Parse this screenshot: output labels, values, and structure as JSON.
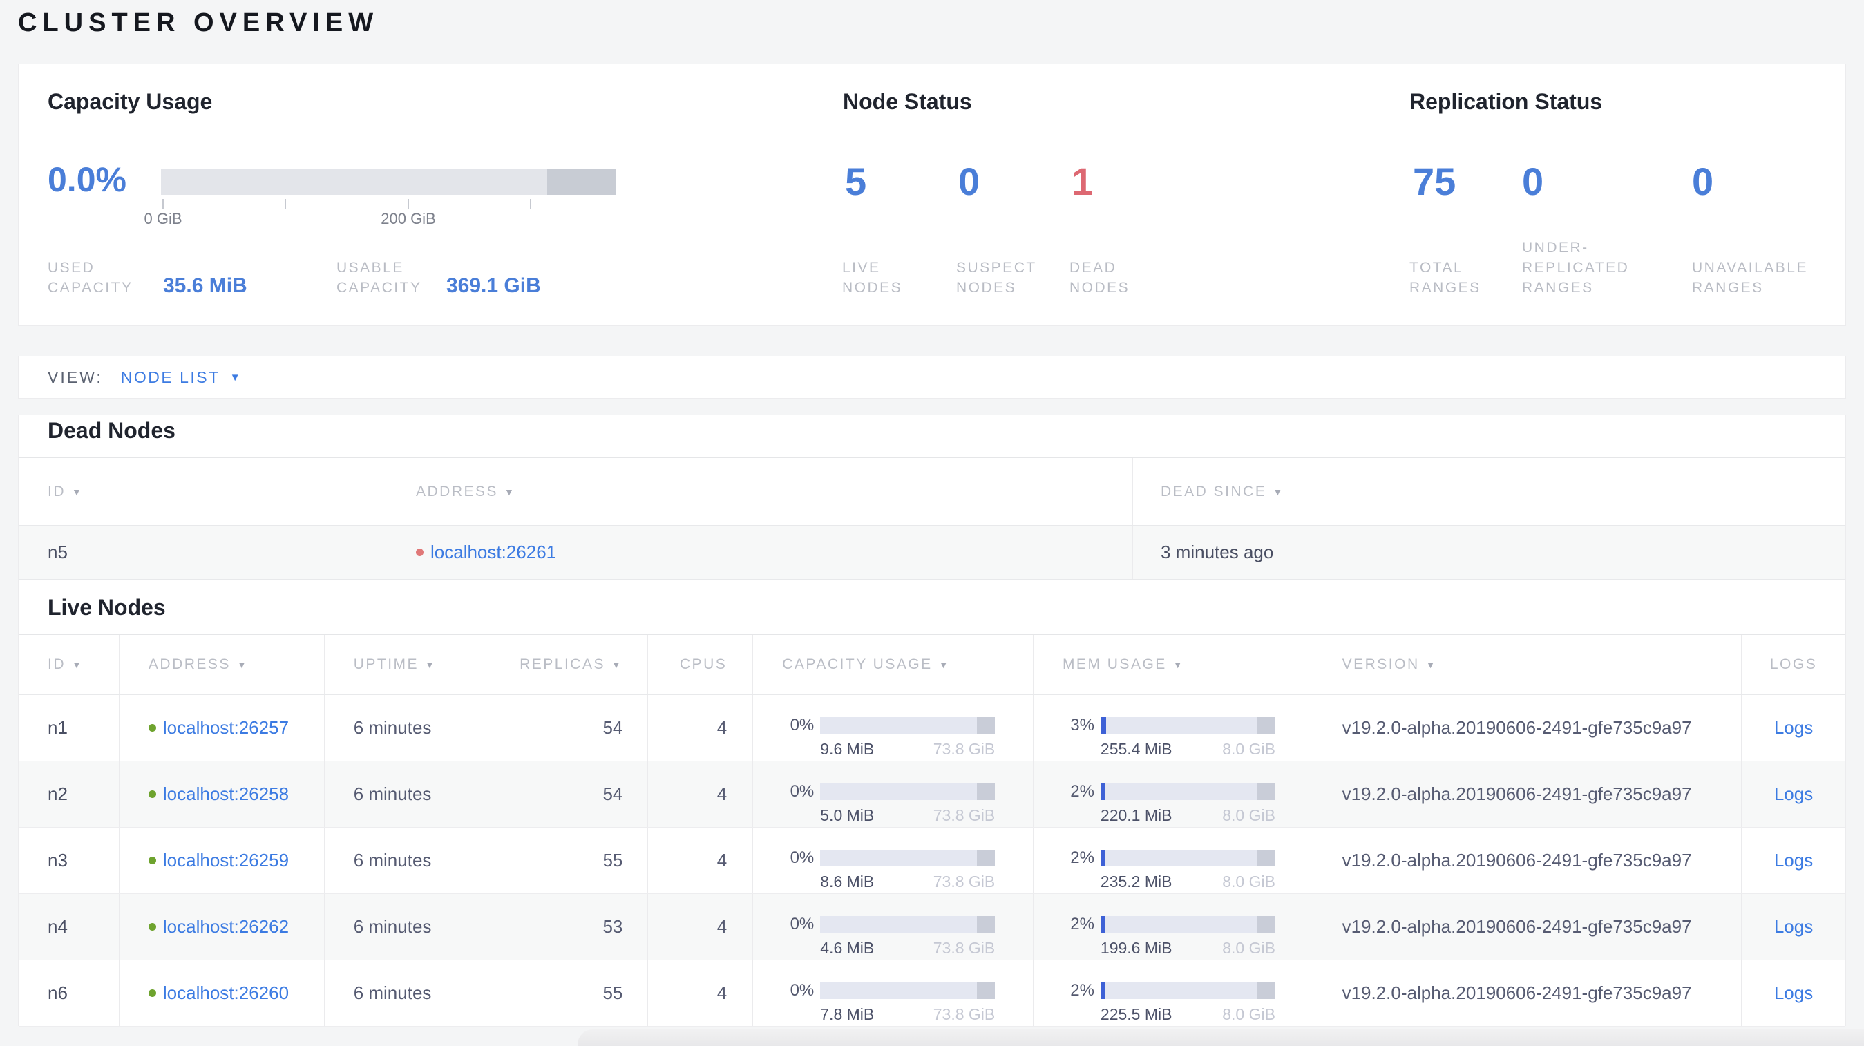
{
  "page": {
    "title": "CLUSTER OVERVIEW"
  },
  "icons": {
    "sort_desc": "▼",
    "dropdown_caret": "▼"
  },
  "colors": {
    "accent_blue": "#4a7ed8",
    "link_blue": "#3c7be2",
    "alert_red": "#dd6872",
    "live_dot_green": "#6ea32e",
    "dead_dot_red": "#e07878",
    "bar_track": "#e4e7f1",
    "bar_reserved": "#c9cdd8",
    "bar_fill_blue": "#3e61d6"
  },
  "summary": {
    "capacity": {
      "title": "Capacity Usage",
      "percent": "0.0%",
      "axis": {
        "tick0_label": "0 GiB",
        "tick2_label": "200 GiB"
      },
      "used": {
        "label": "USED CAPACITY",
        "value": "35.6 MiB"
      },
      "usable": {
        "label": "USABLE CAPACITY",
        "value": "369.1 GiB"
      }
    },
    "node_status": {
      "title": "Node Status",
      "live": {
        "value": "5",
        "label": "LIVE NODES"
      },
      "suspect": {
        "value": "0",
        "label": "SUSPECT NODES"
      },
      "dead": {
        "value": "1",
        "label": "DEAD NODES"
      }
    },
    "replication": {
      "title": "Replication Status",
      "total": {
        "value": "75",
        "label": "TOTAL RANGES"
      },
      "under": {
        "value": "0",
        "label": "UNDER-REPLICATED RANGES"
      },
      "unavailable": {
        "value": "0",
        "label": "UNAVAILABLE RANGES"
      }
    }
  },
  "view_bar": {
    "label": "VIEW:",
    "selected": "NODE LIST"
  },
  "dead_nodes": {
    "title": "Dead Nodes",
    "columns": {
      "id": "ID",
      "address": "ADDRESS",
      "dead_since": "DEAD SINCE"
    },
    "rows": [
      {
        "id": "n5",
        "address": "localhost:26261",
        "dead_since": "3 minutes ago"
      }
    ]
  },
  "live_nodes": {
    "title": "Live Nodes",
    "columns": {
      "id": "ID",
      "address": "ADDRESS",
      "uptime": "UPTIME",
      "replicas": "REPLICAS",
      "cpus": "CPUS",
      "capacity": "CAPACITY USAGE",
      "mem": "MEM USAGE",
      "version": "VERSION",
      "logs": "LOGS"
    },
    "rows": [
      {
        "id": "n1",
        "address": "localhost:26257",
        "uptime": "6 minutes",
        "replicas": "54",
        "cpus": "4",
        "capacity": {
          "percent": "0%",
          "pct": 0,
          "used": "9.6 MiB",
          "total": "73.8 GiB"
        },
        "mem": {
          "percent": "3%",
          "pct": 3,
          "used": "255.4 MiB",
          "total": "8.0 GiB"
        },
        "version": "v19.2.0-alpha.20190606-2491-gfe735c9a97",
        "logs": "Logs"
      },
      {
        "id": "n2",
        "address": "localhost:26258",
        "uptime": "6 minutes",
        "replicas": "54",
        "cpus": "4",
        "capacity": {
          "percent": "0%",
          "pct": 0,
          "used": "5.0 MiB",
          "total": "73.8 GiB"
        },
        "mem": {
          "percent": "2%",
          "pct": 2,
          "used": "220.1 MiB",
          "total": "8.0 GiB"
        },
        "version": "v19.2.0-alpha.20190606-2491-gfe735c9a97",
        "logs": "Logs"
      },
      {
        "id": "n3",
        "address": "localhost:26259",
        "uptime": "6 minutes",
        "replicas": "55",
        "cpus": "4",
        "capacity": {
          "percent": "0%",
          "pct": 0,
          "used": "8.6 MiB",
          "total": "73.8 GiB"
        },
        "mem": {
          "percent": "2%",
          "pct": 2,
          "used": "235.2 MiB",
          "total": "8.0 GiB"
        },
        "version": "v19.2.0-alpha.20190606-2491-gfe735c9a97",
        "logs": "Logs"
      },
      {
        "id": "n4",
        "address": "localhost:26262",
        "uptime": "6 minutes",
        "replicas": "53",
        "cpus": "4",
        "capacity": {
          "percent": "0%",
          "pct": 0,
          "used": "4.6 MiB",
          "total": "73.8 GiB"
        },
        "mem": {
          "percent": "2%",
          "pct": 2,
          "used": "199.6 MiB",
          "total": "8.0 GiB"
        },
        "version": "v19.2.0-alpha.20190606-2491-gfe735c9a97",
        "logs": "Logs"
      },
      {
        "id": "n6",
        "address": "localhost:26260",
        "uptime": "6 minutes",
        "replicas": "55",
        "cpus": "4",
        "capacity": {
          "percent": "0%",
          "pct": 0,
          "used": "7.8 MiB",
          "total": "73.8 GiB"
        },
        "mem": {
          "percent": "2%",
          "pct": 2,
          "used": "225.5 MiB",
          "total": "8.0 GiB"
        },
        "version": "v19.2.0-alpha.20190606-2491-gfe735c9a97",
        "logs": "Logs"
      }
    ]
  }
}
